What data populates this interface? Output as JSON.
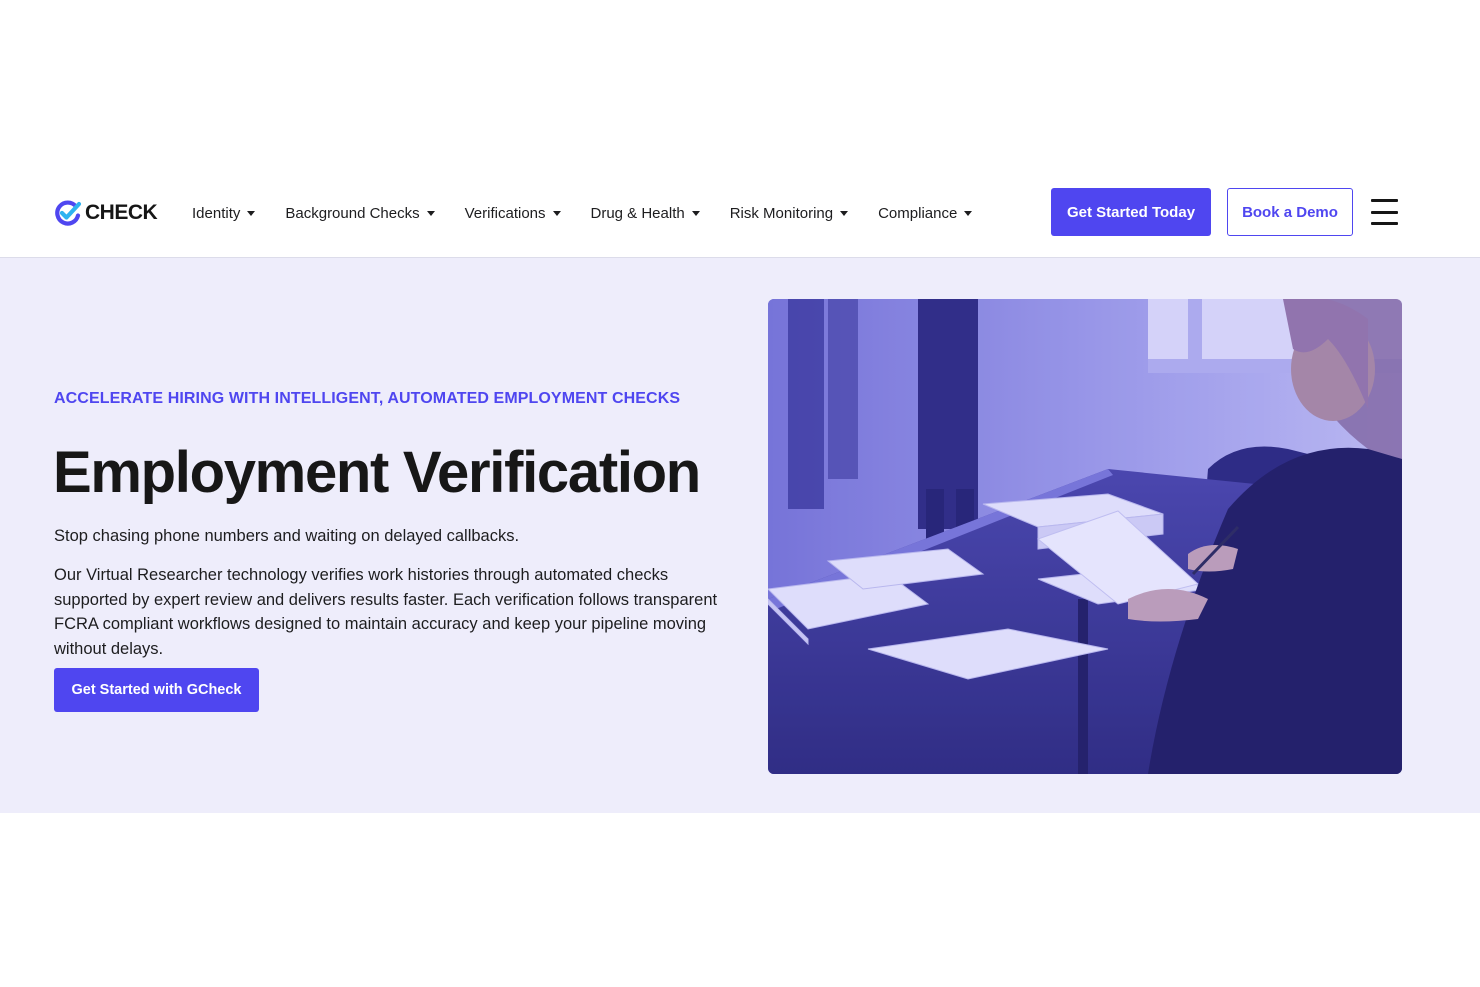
{
  "brand": {
    "logo_text": "CHECK",
    "primary_color": "#4f46f0",
    "hero_background": "#eeedfb"
  },
  "nav": {
    "items": [
      {
        "label": "Identity",
        "icon": "caret-down-icon"
      },
      {
        "label": "Background Checks",
        "icon": "caret-down-icon"
      },
      {
        "label": "Verifications",
        "icon": "caret-down-icon"
      },
      {
        "label": "Drug & Health",
        "icon": "caret-down-icon"
      },
      {
        "label": "Risk Monitoring",
        "icon": "caret-down-icon"
      },
      {
        "label": "Compliance",
        "icon": "caret-down-icon"
      }
    ]
  },
  "header": {
    "cta_primary": "Get Started Today",
    "cta_secondary": "Book a Demo",
    "menu_icon": "hamburger-menu-icon"
  },
  "hero": {
    "eyebrow": "ACCELERATE HIRING WITH INTELLIGENT, AUTOMATED EMPLOYMENT CHECKS",
    "title": "Employment Verification",
    "lead": "Stop chasing phone numbers and waiting on delayed callbacks.",
    "body": "Our Virtual Researcher technology verifies work histories through automated checks supported by expert review and delivers results faster. Each verification follows transparent FCRA compliant workflows designed to maintain accuracy and keep your pipeline moving without delays.",
    "cta": "Get Started with GCheck"
  }
}
